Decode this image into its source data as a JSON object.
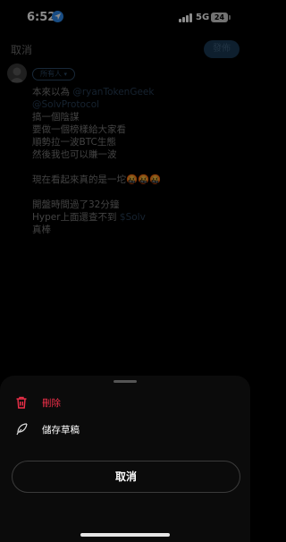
{
  "status_bar": {
    "time": "6:52",
    "network": "5G",
    "battery": "24"
  },
  "header": {
    "cancel_label": "取消",
    "post_label": "發佈"
  },
  "compose": {
    "audience_label": "所有人",
    "lines": [
      {
        "parts": [
          {
            "text": "本來以為 "
          },
          {
            "text": "@ryanTokenGeek",
            "mention": true
          }
        ]
      },
      {
        "parts": [
          {
            "text": "@SolvProtocol",
            "mention": true
          }
        ]
      },
      {
        "parts": [
          {
            "text": "搞一個陰謀"
          }
        ]
      },
      {
        "parts": [
          {
            "text": "要做一個榜樣給大家看"
          }
        ]
      },
      {
        "parts": [
          {
            "text": "順勢拉一波BTC生態"
          }
        ]
      },
      {
        "parts": [
          {
            "text": "然後我也可以賺一波"
          }
        ]
      },
      {
        "parts": [
          {
            "text": ""
          }
        ]
      },
      {
        "parts": [
          {
            "text": "現在看起來真的是一坨🤬🤬🤬"
          }
        ]
      },
      {
        "parts": [
          {
            "text": ""
          }
        ]
      },
      {
        "parts": [
          {
            "text": "開盤時間過了32分鐘"
          }
        ]
      },
      {
        "parts": [
          {
            "text": "Hyper上面還查不到 "
          },
          {
            "text": "$Solv",
            "mention": true
          }
        ]
      },
      {
        "parts": [
          {
            "text": "真棒"
          }
        ]
      }
    ]
  },
  "sheet": {
    "delete_label": "刪除",
    "save_draft_label": "儲存草稿",
    "cancel_label": "取消",
    "icons": {
      "delete": "trash-icon",
      "draft": "feather-icon"
    },
    "colors": {
      "delete": "#f0304a"
    }
  }
}
